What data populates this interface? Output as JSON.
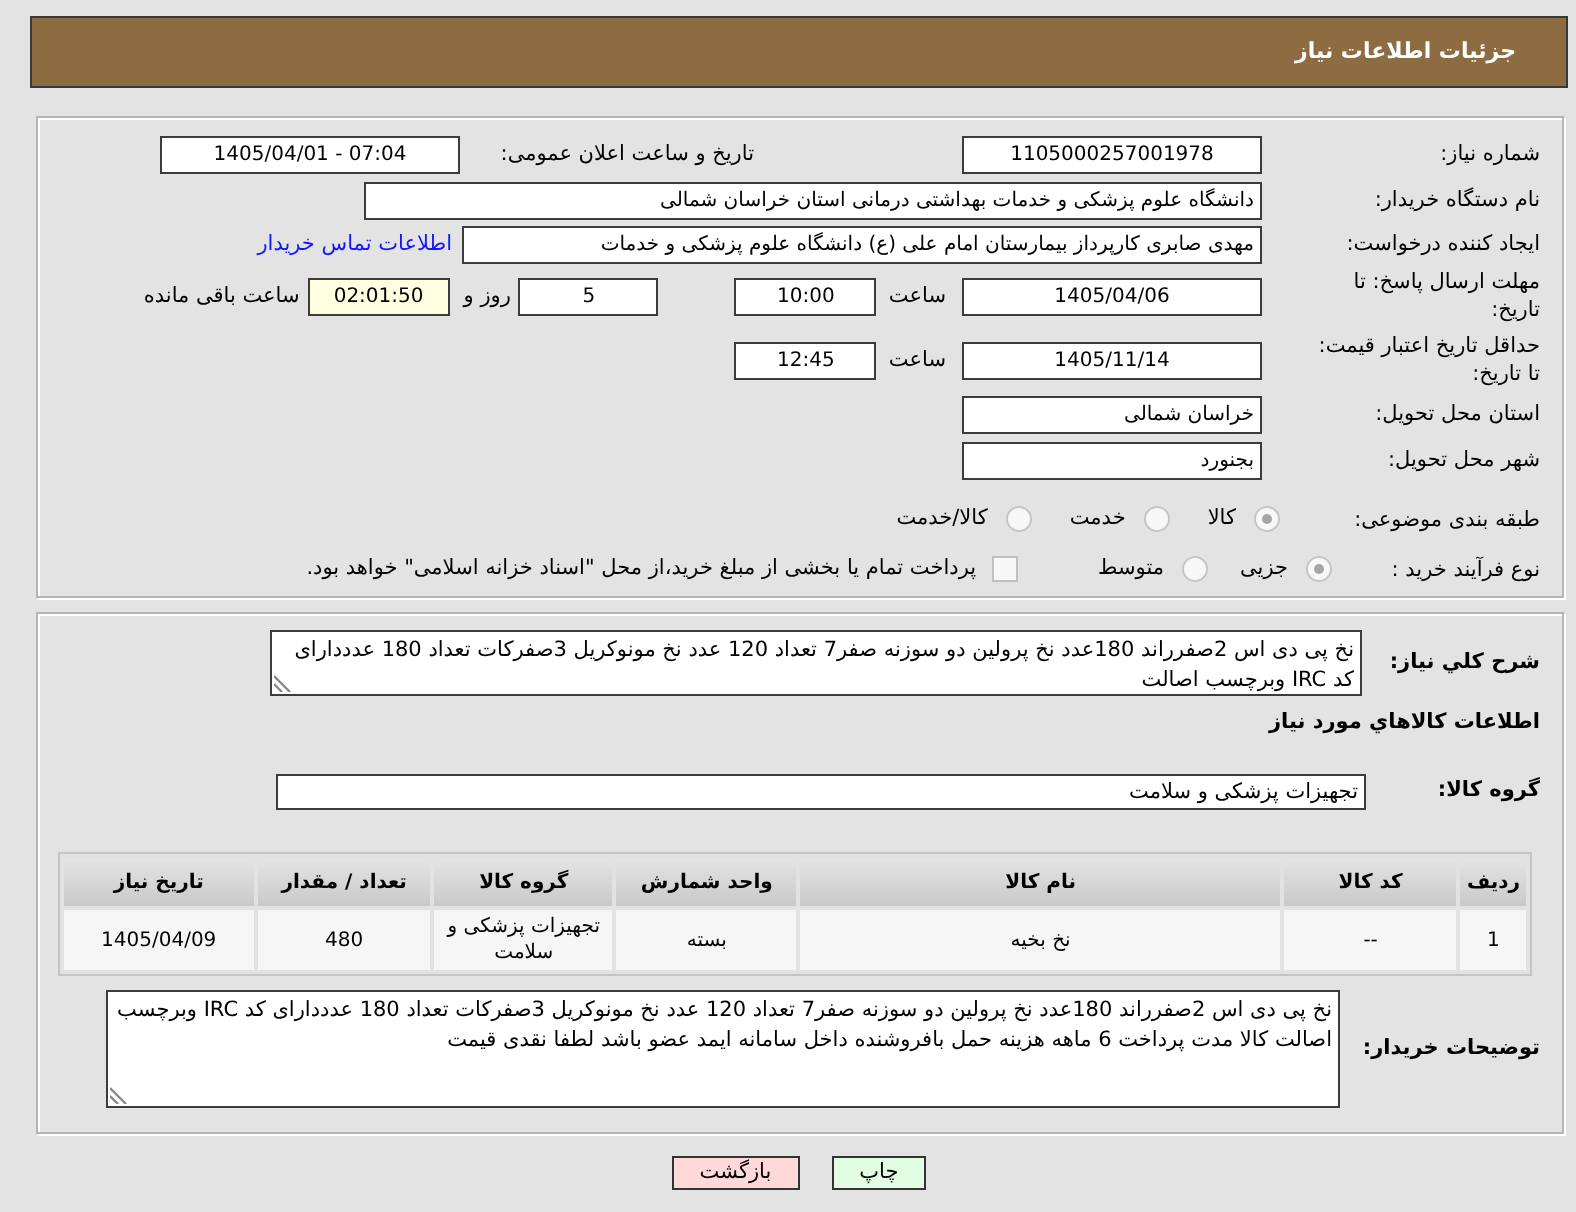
{
  "header": {
    "title": "جزئیات اطلاعات نیاز"
  },
  "need_number": {
    "label": "شماره نیاز:",
    "value": "1105000257001978"
  },
  "announce_datetime": {
    "label": "تاریخ و ساعت اعلان عمومی:",
    "value": "1405/04/01 - 07:04"
  },
  "buyer_org": {
    "label": "نام دستگاه خریدار:",
    "value": "دانشگاه علوم پزشکی و خدمات بهداشتی درمانی استان خراسان شمالی"
  },
  "requester": {
    "label": "ایجاد کننده درخواست:",
    "value": "مهدی صابری کارپرداز بیمارستان امام علی (ع) دانشگاه علوم پزشکی و خدمات",
    "contact_link": "اطلاعات تماس خریدار"
  },
  "response_deadline": {
    "label": "مهلت ارسال پاسخ: تا تاریخ:",
    "date": "1405/04/06",
    "time_label": "ساعت",
    "time": "10:00",
    "days": "5",
    "days_label": "روز و",
    "remaining": "02:01:50",
    "remaining_label": "ساعت باقی مانده"
  },
  "price_validity": {
    "label": "حداقل تاریخ اعتبار قیمت: تا تاریخ:",
    "date": "1405/11/14",
    "time_label": "ساعت",
    "time": "12:45"
  },
  "delivery_province": {
    "label": "استان محل تحویل:",
    "value": "خراسان شمالی"
  },
  "delivery_city": {
    "label": "شهر محل تحویل:",
    "value": "بجنورد"
  },
  "subject_category": {
    "label": "طبقه بندی موضوعی:",
    "options": [
      {
        "label": "کالا",
        "selected": true
      },
      {
        "label": "خدمت",
        "selected": false
      },
      {
        "label": "کالا/خدمت",
        "selected": false
      }
    ]
  },
  "purchase_process": {
    "label": "نوع فرآیند خرید :",
    "options": [
      {
        "label": "جزیی",
        "selected": true
      },
      {
        "label": "متوسط",
        "selected": false
      }
    ],
    "treasury_payment": {
      "label": "پرداخت تمام یا بخشی از مبلغ خرید،از محل \"اسناد خزانه اسلامی\" خواهد بود.",
      "checked": false
    }
  },
  "need_description": {
    "label": "شرح کلي نياز:",
    "text": "نخ پی دی اس 2صفرراند 180عدد نخ پرولین دو سوزنه صفر7 تعداد 120 عدد نخ مونوکریل 3صفرکات تعداد 180 عدددارای کد IRC وبرچسب اصالت"
  },
  "goods_heading": "اطلاعات کالاهاي مورد نياز",
  "goods_group": {
    "label": "گروه کالا:",
    "value": "تجهیزات پزشکی و سلامت"
  },
  "goods_table": {
    "columns": [
      "ردیف",
      "کد کالا",
      "نام کالا",
      "واحد شمارش",
      "گروه کالا",
      "تعداد / مقدار",
      "تاریخ نیاز"
    ],
    "rows": [
      [
        "1",
        "--",
        "نخ بخیه",
        "بسته",
        "تجهیزات پزشکی و سلامت",
        "480",
        "1405/04/09"
      ]
    ]
  },
  "buyer_notes": {
    "label": "توضیحات خریدار:",
    "text": "نخ پی دی اس 2صفرراند 180عدد نخ پرولین دو سوزنه صفر7 تعداد 120 عدد نخ مونوکریل 3صفرکات تعداد 180 عدددارای کد IRC وبرچسب اصالت کالا مدت پرداخت 6 ماهه هزینه حمل بافروشنده داخل سامانه ایمد عضو باشد لطفا نقدی قیمت"
  },
  "buttons": [
    {
      "label": "چاپ",
      "kind": "print"
    },
    {
      "label": "بازگشت",
      "kind": "back"
    }
  ]
}
